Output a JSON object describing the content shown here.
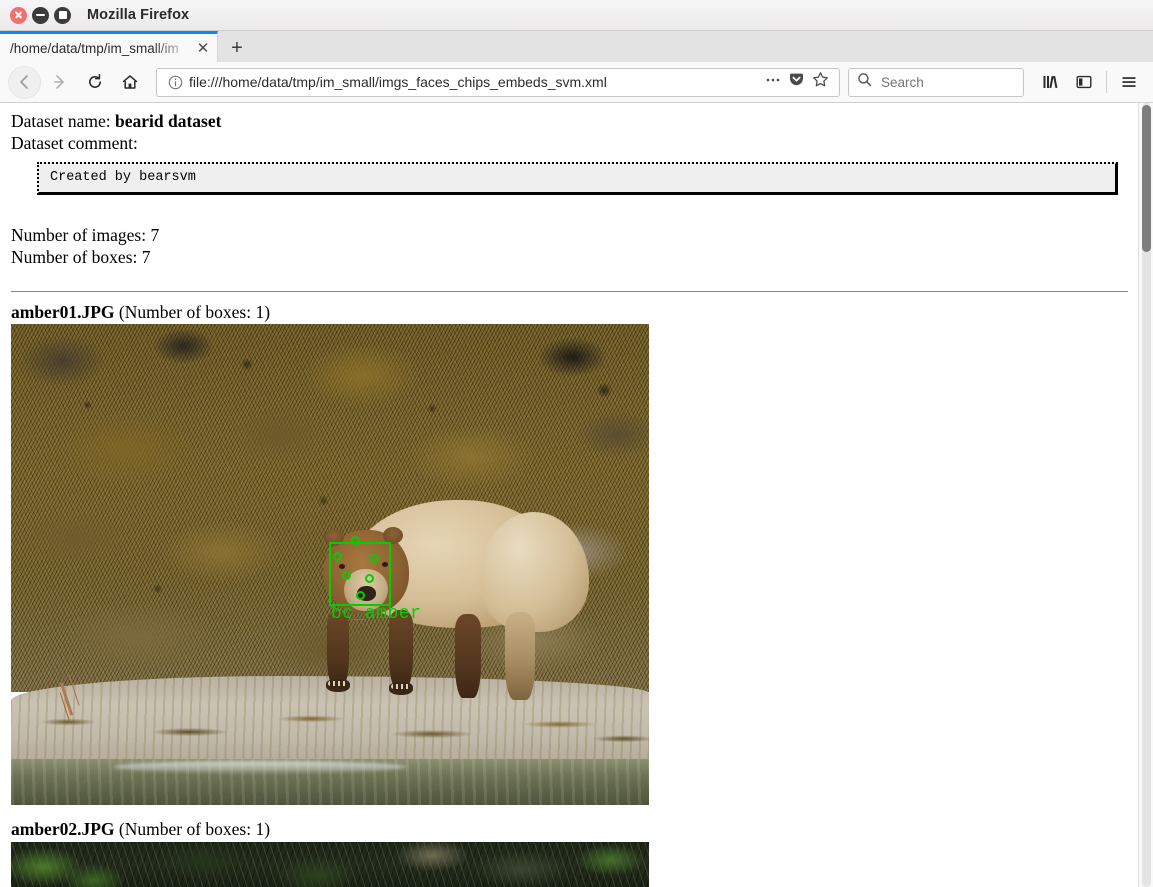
{
  "window": {
    "title": "Mozilla Firefox",
    "controls": {
      "close": "close-button",
      "minimize": "minimize-button",
      "maximize": "maximize-button"
    }
  },
  "tabs": {
    "active_label": "/home/data/tmp/im_small/im",
    "close_glyph": "✕",
    "new_tab_glyph": "+"
  },
  "toolbar": {
    "back_glyph": "←",
    "forward_glyph": "→",
    "reload_glyph": "↻",
    "home_glyph": "⌂",
    "url": "file:///home/data/tmp/im_small/imgs_faces_chips_embeds_svm.xml",
    "overflow_glyph": "…",
    "search_placeholder": "Search",
    "menu_glyph": "☰"
  },
  "page": {
    "dataset_name_label": "Dataset name:",
    "dataset_name_value": "bearid dataset",
    "dataset_comment_label": "Dataset comment:",
    "dataset_comment_value": "Created by bearsvm",
    "number_of_images": "Number of images: 7",
    "number_of_boxes": "Number of boxes: 7",
    "images": [
      {
        "filename": "amber01.JPG",
        "boxes_text": "(Number of boxes: 1)",
        "annotation_label": "bc_amber"
      },
      {
        "filename": "amber02.JPG",
        "boxes_text": "(Number of boxes: 1)",
        "annotation_label": ""
      }
    ]
  },
  "colors": {
    "annotation_green": "#00D000",
    "active_tab_accent": "#0a84ff",
    "close_button": "#f2706f",
    "comment_box_bg": "#efefef"
  }
}
